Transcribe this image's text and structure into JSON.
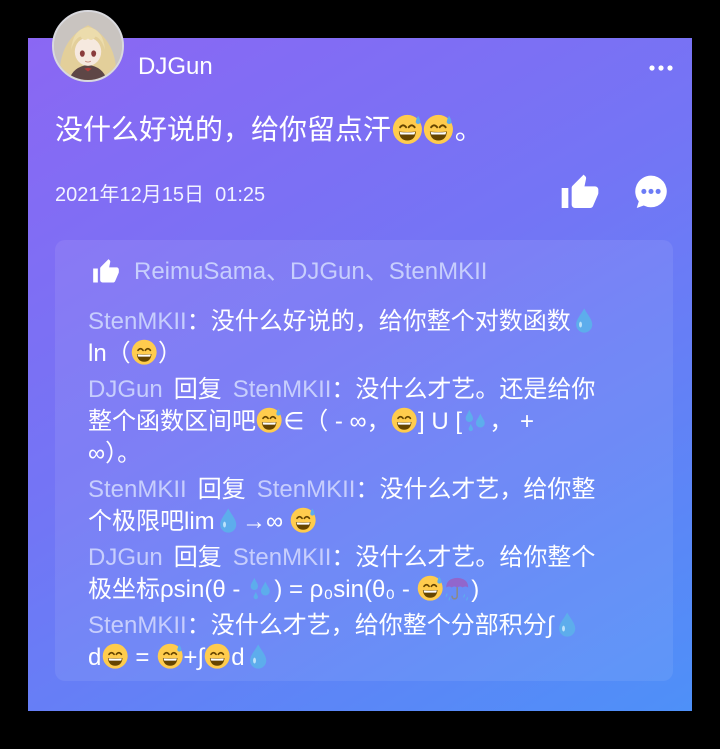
{
  "post": {
    "author_name": "DJGun",
    "avatar_icon": "avatar-image",
    "more_icon": "more-dots-icon",
    "text": "没什么好说的，给你留点汗😅😅。",
    "date": "2021年12月15日  01:25",
    "like_icon": "thumbs-up-icon",
    "comment_icon": "comment-bubble-icon"
  },
  "likes": {
    "icon": "thumbs-up-icon",
    "names": "ReimuSama、DJGun、StenMKII"
  },
  "reply_label": "回复",
  "comment_separator": "：",
  "comments": [
    {
      "author": "StenMKII",
      "reply_to": null,
      "lines": [
        "没什么好说的，给你整个对数函数💧",
        "ln（😄）"
      ]
    },
    {
      "author": "DJGun",
      "reply_to": "StenMKII",
      "lines": [
        "没什么才艺。还是给你",
        "整个函数区间吧😅∈（ - ∞，😄] U [💦， +",
        "∞）。"
      ]
    },
    {
      "author": "StenMKII",
      "reply_to": "StenMKII",
      "lines": [
        "没什么才艺，给你整",
        "个极限吧lim💧→∞ 😅"
      ]
    },
    {
      "author": "DJGun",
      "reply_to": "StenMKII",
      "lines": [
        "没什么才艺。给你整个",
        "极坐标ρsin(θ - 💦) = ρ₀sin(θ₀ - 😅☔)"
      ]
    },
    {
      "author": "StenMKII",
      "reply_to": null,
      "lines": [
        "没什么才艺，给你整个分部积分∫💧",
        "d😄 = 😅+∫😄d💧"
      ]
    }
  ],
  "colors": {
    "background": "#000000",
    "card_gradient_start": "#8b67f3",
    "card_gradient_mid": "#7375f5",
    "card_gradient_end": "#4e90f8",
    "name_text": "#c7cefd",
    "text": "#ffffff"
  }
}
